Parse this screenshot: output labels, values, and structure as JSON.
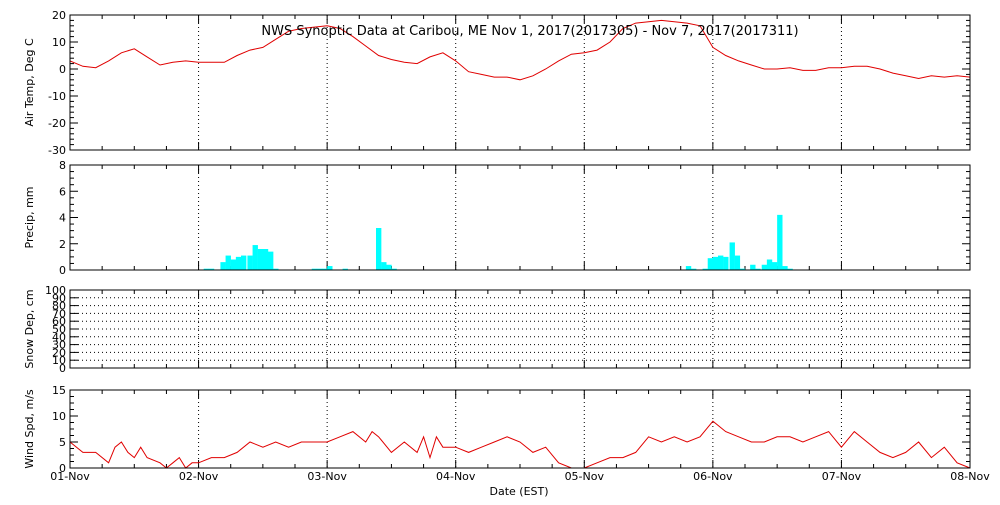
{
  "chart_data": {
    "type": "line",
    "title": "NWS Synoptic Data at Caribou, ME   Nov  1, 2017(2017305) - Nov  7, 2017(2017311)",
    "xlabel": "Date (EST)",
    "x_ticks": [
      "01-Nov",
      "02-Nov",
      "03-Nov",
      "04-Nov",
      "05-Nov",
      "06-Nov",
      "07-Nov",
      "08-Nov"
    ],
    "x_range_days": [
      0,
      7
    ],
    "grid": true,
    "panels": [
      {
        "id": "temp",
        "type": "line",
        "ylabel": "Air Temp, Deg C",
        "ylim": [
          -30,
          20
        ],
        "yticks": [
          -30,
          -20,
          -10,
          0,
          10,
          20
        ],
        "color": "#e00000",
        "series": [
          {
            "x": [
              0,
              0.1,
              0.2,
              0.3,
              0.4,
              0.5,
              0.6,
              0.7,
              0.8,
              0.9,
              1.0,
              1.1,
              1.2,
              1.3,
              1.4,
              1.5,
              1.6,
              1.7,
              1.8,
              1.9,
              2.0,
              2.1,
              2.2,
              2.3,
              2.4,
              2.5,
              2.6,
              2.7,
              2.8,
              2.9,
              3.0,
              3.1,
              3.2,
              3.3,
              3.4,
              3.5,
              3.6,
              3.7,
              3.8,
              3.9,
              4.0,
              4.1,
              4.2,
              4.3,
              4.4,
              4.5,
              4.6,
              4.7,
              4.8,
              4.9,
              5.0,
              5.1,
              5.2,
              5.3,
              5.4,
              5.5,
              5.6,
              5.7,
              5.8,
              5.9,
              6.0,
              6.1,
              6.2,
              6.3,
              6.4,
              6.5,
              6.6,
              6.7,
              6.8,
              6.9,
              7.0
            ],
            "values": [
              3,
              1,
              0.5,
              3,
              6,
              7.5,
              4.5,
              1.5,
              2.5,
              3,
              2.5,
              2.5,
              2.5,
              5,
              7,
              8,
              11,
              14,
              15,
              15.5,
              16,
              15,
              12,
              8.5,
              5,
              3.5,
              2.5,
              2,
              4.5,
              6,
              3,
              -1,
              -2,
              -3,
              -3,
              -4,
              -2.5,
              0,
              3,
              5.5,
              6,
              7,
              10,
              15,
              17,
              17.5,
              18,
              17.5,
              17,
              16,
              8,
              5,
              3,
              1.5,
              0,
              0,
              0.5,
              -0.5,
              -0.5,
              0.5,
              0.5,
              1,
              1,
              0,
              -1.5,
              -2.5,
              -3.5,
              -2.5,
              -3,
              -2.5,
              -3
            ]
          }
        ]
      },
      {
        "id": "precip",
        "type": "bar",
        "ylabel": "Precip, mm",
        "ylim": [
          0,
          8
        ],
        "yticks": [
          0,
          2,
          4,
          6,
          8
        ],
        "color": "#00ffff",
        "bar_width_hours": 1,
        "series": [
          {
            "x": [
              1.04,
              1.08,
              1.17,
              1.21,
              1.25,
              1.29,
              1.33,
              1.38,
              1.42,
              1.46,
              1.5,
              1.54,
              1.58,
              1.88,
              1.92,
              1.96,
              2.0,
              2.12,
              2.38,
              2.42,
              2.46,
              2.5,
              4.79,
              4.83,
              4.92,
              4.96,
              5.0,
              5.04,
              5.08,
              5.13,
              5.17,
              5.21,
              5.29,
              5.33,
              5.38,
              5.42,
              5.46,
              5.5,
              5.54,
              5.58
            ],
            "values": [
              0.1,
              0.1,
              0.6,
              1.1,
              0.8,
              1.0,
              1.1,
              1.1,
              1.9,
              1.6,
              1.6,
              1.4,
              0.1,
              0.1,
              0.1,
              0.1,
              0.3,
              0.1,
              3.2,
              0.6,
              0.4,
              0.1,
              0.3,
              0.1,
              0.1,
              0.9,
              1.0,
              1.1,
              1.0,
              2.1,
              1.1,
              0.1,
              0.4,
              0.1,
              0.4,
              0.8,
              0.6,
              4.2,
              0.3,
              0.1
            ]
          }
        ]
      },
      {
        "id": "snow",
        "type": "line",
        "ylabel": "Snow Dep, cm",
        "ylim": [
          0,
          100
        ],
        "yticks": [
          0,
          10,
          20,
          30,
          40,
          50,
          60,
          70,
          80,
          90,
          100
        ],
        "series": []
      },
      {
        "id": "wind",
        "type": "line",
        "ylabel": "Wind Spd, m/s",
        "ylim": [
          0,
          15
        ],
        "yticks": [
          0,
          5,
          10,
          15
        ],
        "color": "#e00000",
        "series": [
          {
            "x": [
              0,
              0.1,
              0.2,
              0.3,
              0.35,
              0.4,
              0.45,
              0.5,
              0.55,
              0.6,
              0.7,
              0.75,
              0.8,
              0.85,
              0.9,
              0.95,
              1.0,
              1.1,
              1.2,
              1.3,
              1.4,
              1.5,
              1.6,
              1.7,
              1.8,
              1.9,
              2.0,
              2.1,
              2.2,
              2.3,
              2.35,
              2.4,
              2.5,
              2.6,
              2.7,
              2.75,
              2.8,
              2.85,
              2.9,
              2.95,
              3.0,
              3.1,
              3.2,
              3.3,
              3.4,
              3.5,
              3.6,
              3.7,
              3.8,
              3.9,
              4.0,
              4.1,
              4.2,
              4.3,
              4.4,
              4.5,
              4.6,
              4.7,
              4.8,
              4.9,
              5.0,
              5.1,
              5.2,
              5.3,
              5.4,
              5.5,
              5.6,
              5.7,
              5.8,
              5.9,
              6.0,
              6.1,
              6.2,
              6.3,
              6.4,
              6.5,
              6.6,
              6.7,
              6.8,
              6.9,
              7.0
            ],
            "values": [
              5,
              3,
              3,
              1,
              4,
              5,
              3,
              2,
              4,
              2,
              1,
              0,
              1,
              2,
              0,
              1,
              1,
              2,
              2,
              3,
              5,
              4,
              5,
              4,
              5,
              5,
              5,
              6,
              7,
              5,
              7,
              6,
              3,
              5,
              3,
              6,
              2,
              6,
              4,
              4,
              4,
              3,
              4,
              5,
              6,
              5,
              3,
              4,
              1,
              0,
              0,
              1,
              2,
              2,
              3,
              6,
              5,
              6,
              5,
              6,
              9,
              7,
              6,
              5,
              5,
              6,
              6,
              5,
              6,
              7,
              4,
              7,
              5,
              3,
              2,
              3,
              5,
              2,
              4,
              1,
              0
            ]
          }
        ]
      }
    ]
  }
}
